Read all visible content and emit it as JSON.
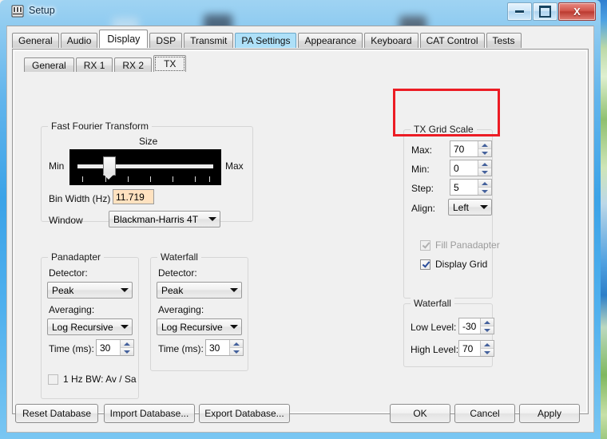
{
  "window": {
    "title": "Setup",
    "icon": "application-icon",
    "buttons": {
      "minimize": "minimize-icon",
      "maximize": "maximize-icon",
      "close": "X"
    }
  },
  "outer_tabs": [
    {
      "label": "General",
      "state": "normal"
    },
    {
      "label": "Audio",
      "state": "normal"
    },
    {
      "label": "Display",
      "state": "selected"
    },
    {
      "label": "DSP",
      "state": "normal"
    },
    {
      "label": "Transmit",
      "state": "normal"
    },
    {
      "label": "PA Settings",
      "state": "highlight"
    },
    {
      "label": "Appearance",
      "state": "normal"
    },
    {
      "label": "Keyboard",
      "state": "normal"
    },
    {
      "label": "CAT Control",
      "state": "normal"
    },
    {
      "label": "Tests",
      "state": "normal"
    }
  ],
  "inner_tabs": [
    {
      "label": "General",
      "state": "normal"
    },
    {
      "label": "RX 1",
      "state": "normal"
    },
    {
      "label": "RX 2",
      "state": "normal"
    },
    {
      "label": "TX",
      "state": "selected"
    }
  ],
  "fft": {
    "title": "Fast Fourier Transform",
    "size_label": "Size",
    "min_label": "Min",
    "max_label": "Max",
    "bin_width_label": "Bin Width (Hz)",
    "bin_width_value": "11.719",
    "window_label": "Window",
    "window_value": "Blackman-Harris 4T"
  },
  "panadapter": {
    "title": "Panadapter",
    "detector_label": "Detector:",
    "detector_value": "Peak",
    "averaging_label": "Averaging:",
    "averaging_value": "Log Recursive",
    "time_label": "Time (ms):",
    "time_value": "30",
    "bw_checkbox_label": "1 Hz BW: Av / Sa",
    "bw_checked": false
  },
  "waterfall_left": {
    "title": "Waterfall",
    "detector_label": "Detector:",
    "detector_value": "Peak",
    "averaging_label": "Averaging:",
    "averaging_value": "Log Recursive",
    "time_label": "Time (ms):",
    "time_value": "30"
  },
  "tx_grid_scale": {
    "title": "TX Grid Scale",
    "max_label": "Max:",
    "max_value": "70",
    "min_label": "Min:",
    "min_value": "0",
    "step_label": "Step:",
    "step_value": "5",
    "align_label": "Align:",
    "align_value": "Left",
    "fill_panadapter_label": "Fill Panadapter",
    "fill_panadapter_checked": true,
    "fill_panadapter_disabled": true,
    "display_grid_label": "Display Grid",
    "display_grid_checked": true
  },
  "waterfall_right": {
    "title": "Waterfall",
    "low_level_label": "Low Level:",
    "low_level_value": "-30",
    "high_level_label": "High Level:",
    "high_level_value": "70"
  },
  "footer": {
    "reset_database": "Reset Database",
    "import_database": "Import Database...",
    "export_database": "Export Database...",
    "ok": "OK",
    "cancel": "Cancel",
    "apply": "Apply"
  },
  "annotation": {
    "color": "#ec1c24",
    "note": "red-highlight-rectangle"
  }
}
